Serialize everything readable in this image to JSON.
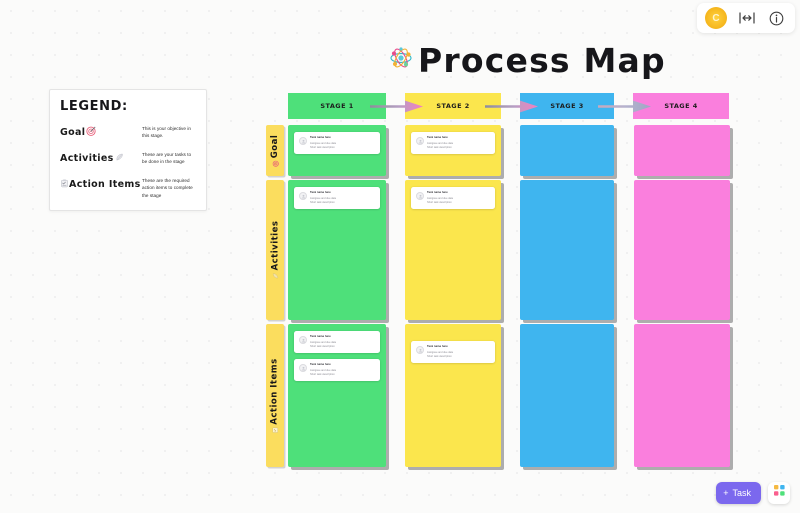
{
  "header": {
    "avatar_initial": "C",
    "fit_icon": "fit-width-icon",
    "info_icon": "info-icon"
  },
  "title": {
    "text": "Process Map",
    "icon": "atom-decoration-icon"
  },
  "legend": {
    "title": "LEGEND:",
    "rows": [
      {
        "term": "Goal",
        "icon": "target-icon",
        "desc": "This is your objective in this stage."
      },
      {
        "term": "Activities",
        "icon": "feather-icon",
        "desc": "These are your tasks to be done in the stage"
      },
      {
        "term": "Action Items",
        "icon": "checklist-icon",
        "desc": "These are the required action items to complete the stage"
      }
    ]
  },
  "board": {
    "stages": [
      {
        "label": "STAGE 1",
        "color": "#4ee07a"
      },
      {
        "label": "STAGE 2",
        "color": "#fbe64d"
      },
      {
        "label": "STAGE 3",
        "color": "#3fb5ef"
      },
      {
        "label": "STAGE 4",
        "color": "#fa7fdd"
      }
    ],
    "rows": [
      {
        "label": "Goal",
        "icon": "target-icon"
      },
      {
        "label": "Activities",
        "icon": "feather-icon"
      },
      {
        "label": "Action Items",
        "icon": "checklist-icon"
      }
    ],
    "cards": {
      "goal_s1": [
        {
          "title": "Task name here",
          "lines": [
            "Assignee and due date",
            "Short task description"
          ]
        }
      ],
      "goal_s2": [
        {
          "title": "Task name here",
          "lines": [
            "Assignee and due date",
            "Short task description"
          ]
        }
      ],
      "activities_s1": [
        {
          "title": "Task name here",
          "lines": [
            "Assignee and due date",
            "Short task description"
          ]
        }
      ],
      "activities_s2": [
        {
          "title": "Task name here",
          "lines": [
            "Assignee and due date",
            "Short task description"
          ]
        }
      ],
      "action_s1": [
        {
          "title": "Task name here",
          "lines": [
            "Assignee and due date",
            "Short task description"
          ]
        },
        {
          "title": "Task name here",
          "lines": [
            "Assignee and due date",
            "Short task description"
          ]
        }
      ],
      "action_s2": [
        {
          "title": "Task name here",
          "lines": [
            "Assignee and due date",
            "Short task description"
          ]
        }
      ]
    }
  },
  "bottom": {
    "task_label": "Task",
    "task_plus": "+",
    "apps_icon": "apps-grid-icon"
  }
}
